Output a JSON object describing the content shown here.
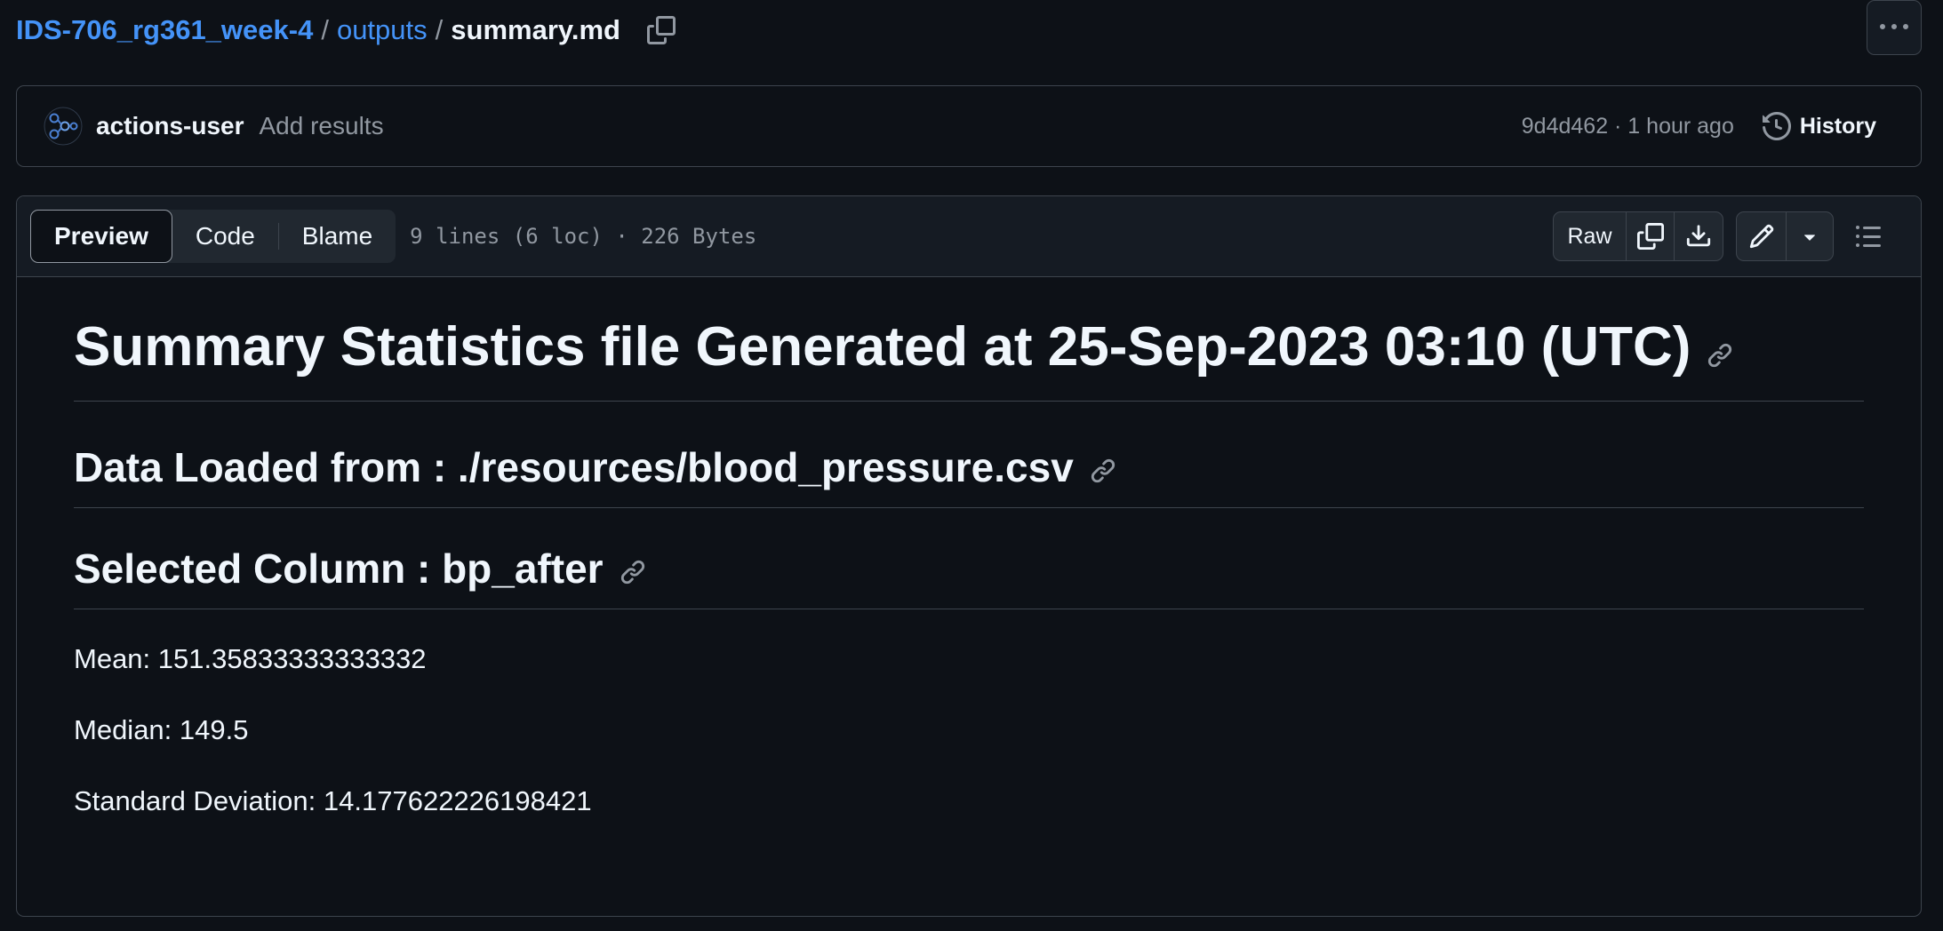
{
  "breadcrumb": {
    "repo": "IDS-706_rg361_week-4",
    "separator": "/",
    "folder": "outputs",
    "file": "summary.md"
  },
  "commit": {
    "author": "actions-user",
    "message": "Add results",
    "meta": "9d4d462 · 1 hour ago",
    "history_label": "History"
  },
  "file_header": {
    "tabs": [
      "Preview",
      "Code",
      "Blame"
    ],
    "active_tab": "Preview",
    "info": "9 lines (6 loc) · 226 Bytes",
    "raw_label": "Raw"
  },
  "markdown": {
    "h1": "Summary Statistics file Generated at 25-Sep-2023 03:10 (UTC)",
    "h2_data": "Data Loaded from : ./resources/blood_pressure.csv",
    "h2_column": "Selected Column : bp_after",
    "mean": "Mean: 151.35833333333332",
    "median": "Median: 149.5",
    "std": "Standard Deviation: 14.177622226198421"
  },
  "colors": {
    "background": "#0d1117",
    "link": "#4493f8",
    "border": "#3d444d",
    "muted": "#9198a1",
    "text": "#f0f6fc"
  }
}
